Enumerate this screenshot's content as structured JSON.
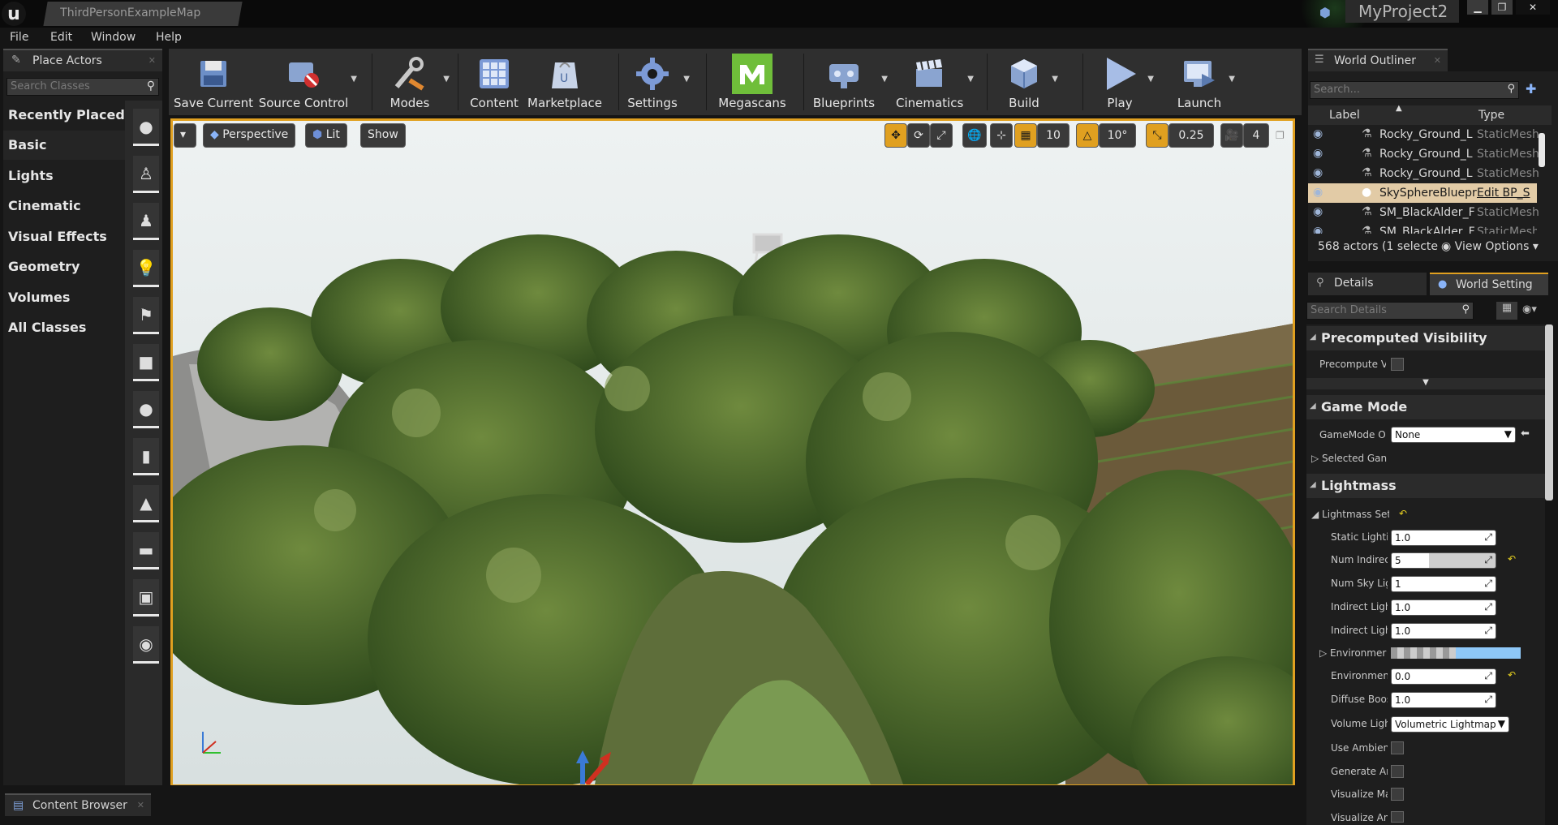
{
  "app": {
    "map_tab": "ThirdPersonExampleMap",
    "project": "MyProject2"
  },
  "menu": [
    "File",
    "Edit",
    "Window",
    "Help"
  ],
  "place_actors": {
    "title": "Place Actors",
    "search_placeholder": "Search Classes",
    "categories": [
      "Recently Placed",
      "Basic",
      "Lights",
      "Cinematic",
      "Visual Effects",
      "Geometry",
      "Volumes",
      "All Classes"
    ],
    "selected": "Basic"
  },
  "toolbar": {
    "buttons": [
      {
        "label": "Save Current",
        "icon": "save-icon"
      },
      {
        "label": "Source Control",
        "icon": "source-control-icon"
      },
      {
        "label": "Modes",
        "icon": "modes-icon"
      },
      {
        "label": "Content",
        "icon": "content-icon"
      },
      {
        "label": "Marketplace",
        "icon": "marketplace-icon"
      },
      {
        "label": "Settings",
        "icon": "settings-icon"
      },
      {
        "label": "Megascans",
        "icon": "megascans-icon"
      },
      {
        "label": "Blueprints",
        "icon": "blueprints-icon"
      },
      {
        "label": "Cinematics",
        "icon": "cinematics-icon"
      },
      {
        "label": "Build",
        "icon": "build-icon"
      },
      {
        "label": "Play",
        "icon": "play-icon"
      },
      {
        "label": "Launch",
        "icon": "launch-icon"
      }
    ],
    "megascans_color": "#6fbe3a"
  },
  "viewport": {
    "perspective": "Perspective",
    "lit": "Lit",
    "show": "Show",
    "grid_snap": "10",
    "rotation_snap": "10°",
    "scale_snap": "0.25",
    "camera_speed": "4",
    "accent": "#e0a020"
  },
  "world_outliner": {
    "title": "World Outliner",
    "search_placeholder": "Search...",
    "col_label": "Label",
    "col_type": "Type",
    "rows": [
      {
        "label": "Rocky_Ground_L",
        "type": "StaticMesh"
      },
      {
        "label": "Rocky_Ground_L",
        "type": "StaticMesh"
      },
      {
        "label": "Rocky_Ground_L",
        "type": "StaticMesh"
      },
      {
        "label": "SkySphereBluepr",
        "type": "Edit BP_S"
      },
      {
        "label": "SM_BlackAlder_F",
        "type": "StaticMesh"
      },
      {
        "label": "SM_BlackAlder_F",
        "type": "StaticMesh"
      }
    ],
    "footer": "568 actors (1 selecte",
    "view_options": "View Options"
  },
  "details_tab": "Details",
  "world_settings_tab": "World Setting",
  "search_details": "Search Details",
  "sections": {
    "precomputed_visibility": "Precomputed Visibility",
    "game_mode": "Game Mode",
    "lightmass": "Lightmass"
  },
  "props": {
    "precompute_v": "Precompute V",
    "gamemode_o": "GameMode O",
    "gamemode_value": "None",
    "selected_gan": "Selected Gan",
    "lightmass_set": "Lightmass Set",
    "static_lighting": "Static Lighti",
    "static_lighting_val": "1.0",
    "num_indirect": "Num Indirec",
    "num_indirect_val": "5",
    "num_sky": "Num Sky Lig",
    "num_sky_val": "1",
    "indirect1": "Indirect Ligh",
    "indirect1_val": "1.0",
    "indirect2": "Indirect Ligh",
    "indirect2_val": "1.0",
    "environment_color": "Environmer",
    "environment_intensity": "Environmen",
    "environment_intensity_val": "0.0",
    "diffuse": "Diffuse Boos",
    "diffuse_val": "1.0",
    "volume_light": "Volume Ligh",
    "volume_light_val": "Volumetric Lightmap",
    "use_ambient": "Use Ambien",
    "generate": "Generate Ar",
    "visualize_m": "Visualize Ma",
    "visualize_a": "Visualize An"
  },
  "content_browser": "Content Browser"
}
